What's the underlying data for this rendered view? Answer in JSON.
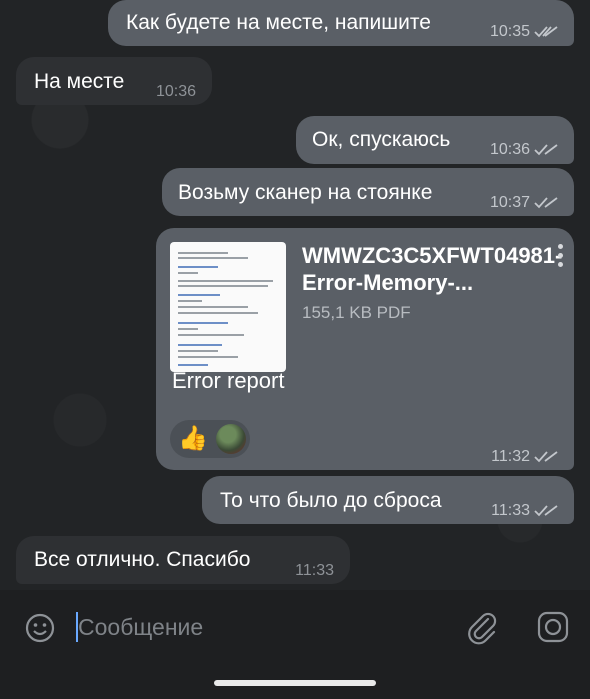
{
  "messages": [
    {
      "text": "Как будете на месте, напишите",
      "time": "10:35"
    },
    {
      "text": "На месте",
      "time": "10:36"
    },
    {
      "text": "Ок, спускаюсь",
      "time": "10:36"
    },
    {
      "text": "Возьму сканер на стоянке",
      "time": "10:37"
    },
    {
      "file_name": "WMWZC3C5XFWT04981-Error-Memory-...",
      "file_size": "155,1 KB PDF",
      "caption": "Error report",
      "time": "11:32",
      "reactions": [
        "thumbs-up",
        "avatar"
      ]
    },
    {
      "text": "То что было до сброса",
      "time": "11:33"
    },
    {
      "text": "Все отлично. Спасибо",
      "time": "11:33"
    }
  ],
  "input": {
    "placeholder": "Сообщение"
  },
  "colors": {
    "outgoing": "#5a5f66",
    "incoming": "#2e3033",
    "background": "#222426",
    "accent": "#6aa9ff"
  }
}
